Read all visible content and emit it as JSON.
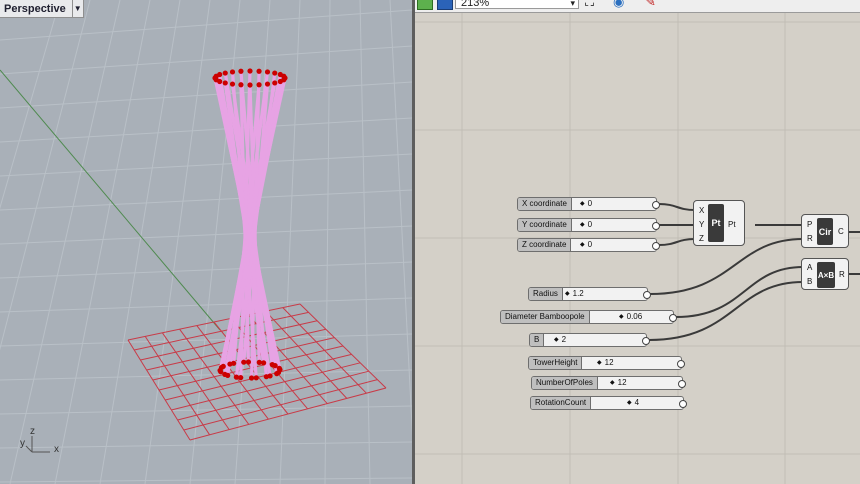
{
  "viewport": {
    "title": "Perspective",
    "axis_labels": {
      "z": "z",
      "y": "y",
      "x": "x"
    }
  },
  "toolbar": {
    "zoom_value": "213%",
    "icons": [
      "new-document-icon",
      "save-icon",
      "zoom-extents-icon",
      "preview-eye-icon",
      "bake-icon"
    ]
  },
  "colors": {
    "viewport_bg": "#a9b0b8",
    "canvas_bg": "#d4d0c8",
    "pole": "#e7a3e4",
    "point": "#cc0000",
    "grid": "#c83b48"
  },
  "sliders": [
    {
      "name": "X coordinate",
      "value": "0"
    },
    {
      "name": "Y coordinate",
      "value": "0"
    },
    {
      "name": "Z coordinate",
      "value": "0"
    },
    {
      "name": "Radius",
      "value": "1.2"
    },
    {
      "name": "Diameter Bamboopole",
      "value": "0.06"
    },
    {
      "name": "B",
      "value": "2"
    },
    {
      "name": "TowerHeight",
      "value": "12"
    },
    {
      "name": "NumberOfPoles",
      "value": "12"
    },
    {
      "name": "RotationCount",
      "value": "4"
    }
  ],
  "components": {
    "point": {
      "label": "Pt",
      "inputs": [
        "X",
        "Y",
        "Z"
      ],
      "output": "Pt"
    },
    "circle": {
      "label": "Cir",
      "inputs": [
        "P",
        "R"
      ],
      "output": "C"
    },
    "multiply": {
      "label": "A×B",
      "inputs": [
        "A",
        "B"
      ],
      "output": "R"
    }
  }
}
